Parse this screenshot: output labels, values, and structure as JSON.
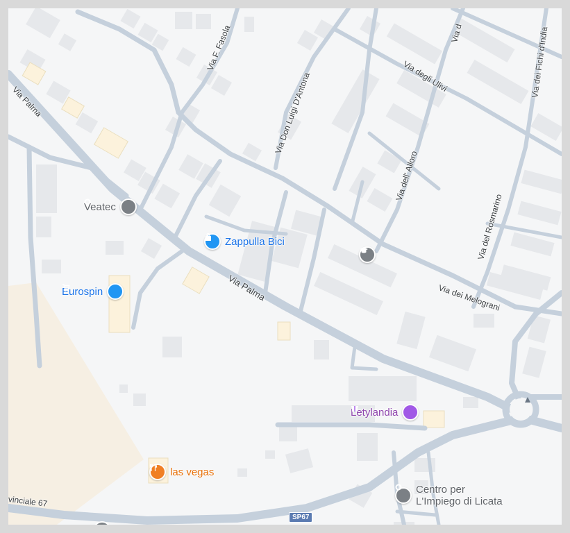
{
  "colors": {
    "background": "#f5f6f7",
    "road": "#c5d0dc",
    "road_major": "#c0ccd9",
    "building": "#e6e8eb",
    "building_commercial": "#fcf2dc",
    "sand_area": "#f6efe3",
    "pin_gray": "#7b8085",
    "pin_blue": "#2196f3",
    "pin_purple": "#a159e6",
    "pin_orange": "#f07f24"
  },
  "pois": [
    {
      "label": "Veatec",
      "icon": "gray-pin-icon",
      "color": "#5f6368"
    },
    {
      "label": "Zappulla Bici",
      "icon": "shopping-bag-icon",
      "color": "#1a73e8"
    },
    {
      "label": "Eurospin",
      "icon": "shopping-cart-icon",
      "color": "#1a73e8"
    },
    {
      "label": "Letylandia",
      "icon": "gift-icon",
      "color": "#8e44ad"
    },
    {
      "label": "las vegas",
      "icon": "restaurant-icon",
      "color": "#e8710a"
    },
    {
      "label": "Centro per\nL'Impiego di Licata",
      "icon": "gray-pin-icon",
      "color": "#5f6368"
    },
    {
      "label": "",
      "icon": "school-icon",
      "color": "#5f6368"
    }
  ],
  "streets": {
    "via_palma_1": "Via Palma",
    "via_palma_2": "Via Palma",
    "via_fasola": "Via F. Fasola",
    "via_don_luigi": "Via Don Luigi D'Antona",
    "via_ulivi": "Via degli Ulivi",
    "via_alloro": "Via dell' Alloro",
    "via_rosmarino": "Via del Rosmarino",
    "via_melograni": "Via dei Melograni",
    "via_fichi": "Via dei Fichi d'India",
    "via_top_right": "Via d",
    "provinciale": "vinciale 67"
  },
  "shields": {
    "sp67": "SP67"
  }
}
